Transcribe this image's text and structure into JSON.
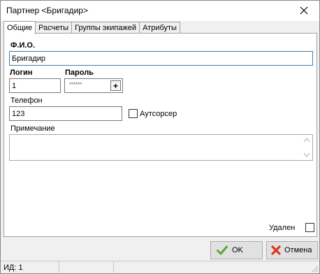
{
  "window": {
    "title": "Партнер <Бригадир>"
  },
  "tabs": [
    {
      "label": "Общие",
      "active": true
    },
    {
      "label": "Расчеты",
      "active": false
    },
    {
      "label": "Группы экипажей",
      "active": false
    },
    {
      "label": "Атрибуты",
      "active": false
    }
  ],
  "form": {
    "fio_label": "Ф.И.О.",
    "fio_value": "Бригадир",
    "login_label": "Логин",
    "login_value": "1",
    "password_label": "Пароль",
    "password_mask": "******",
    "password_button": "+",
    "phone_label": "Телефон",
    "phone_value": "123",
    "outsourcer_label": "Аутсорсер",
    "outsourcer_checked": false,
    "note_label": "Примечание",
    "note_value": "",
    "deleted_label": "Удален",
    "deleted_checked": false
  },
  "buttons": {
    "ok_label": "OK",
    "cancel_label": "Отмена"
  },
  "status": {
    "id_text": "ИД: 1"
  },
  "colors": {
    "ok_icon": "#5aa832",
    "cancel_icon": "#d9391f",
    "focus_border": "#3c7fb1"
  }
}
